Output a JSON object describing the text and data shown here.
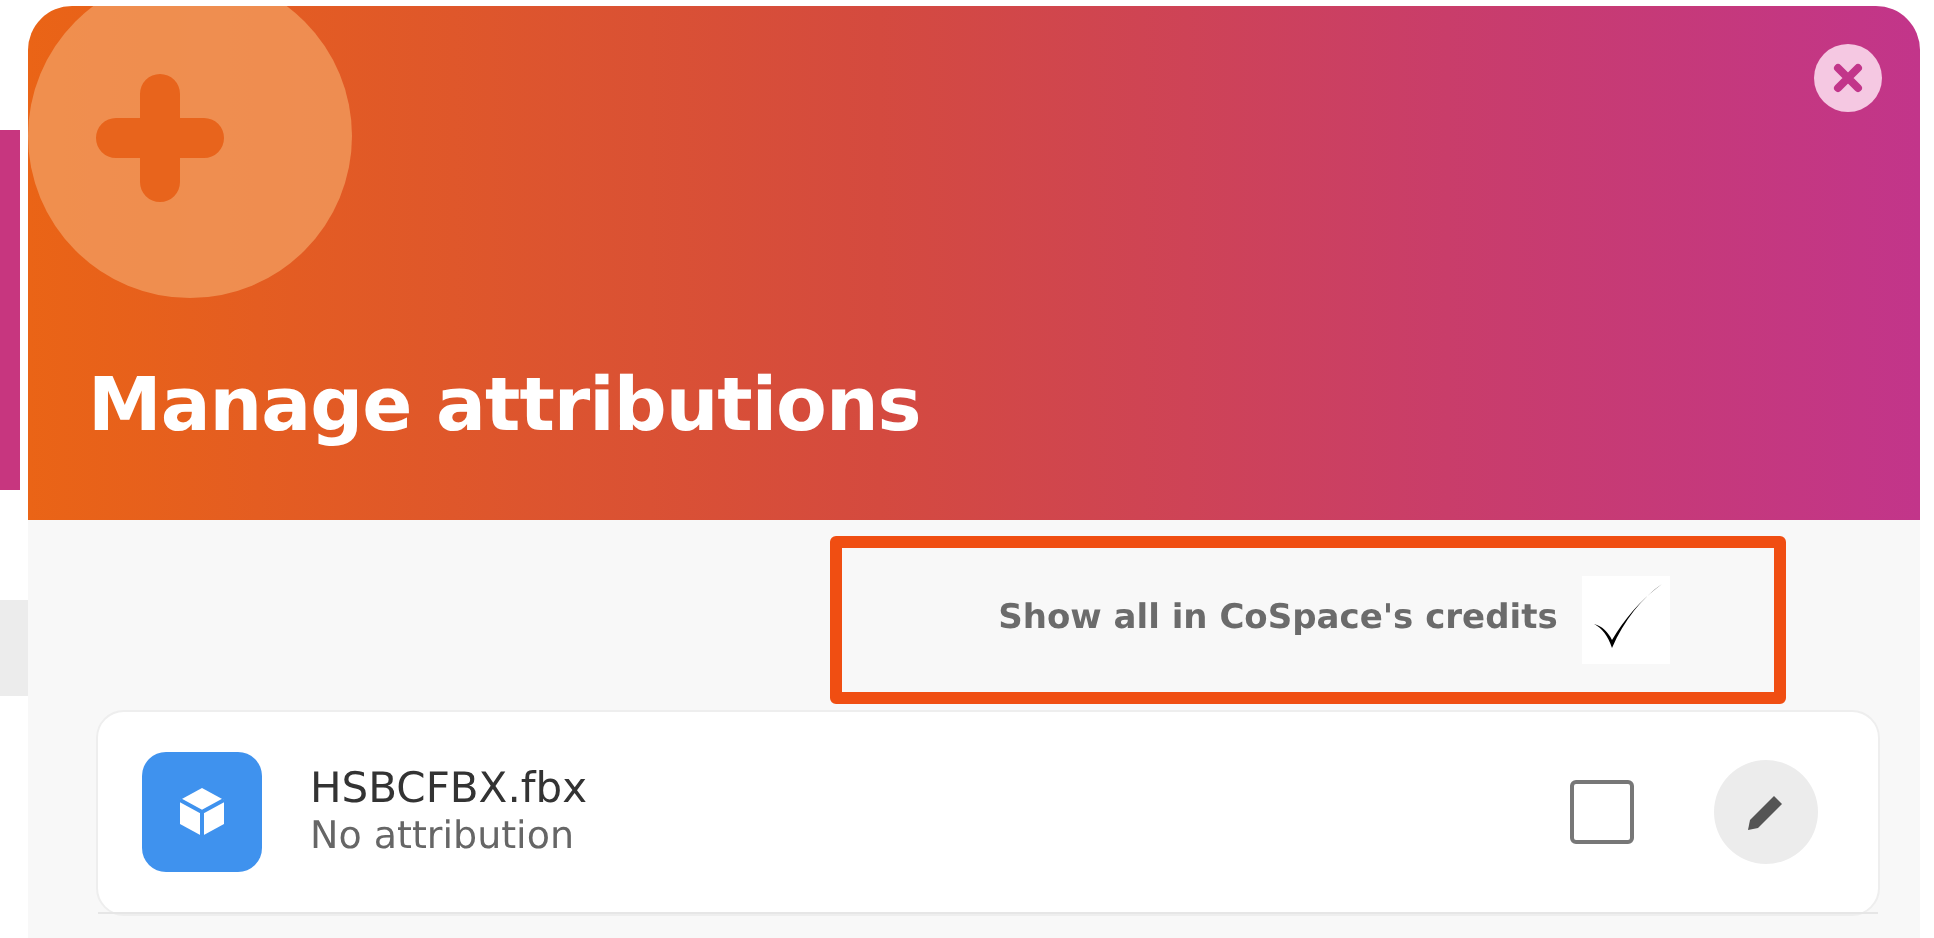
{
  "dialog": {
    "title": "Manage attributions"
  },
  "credits_toggle": {
    "label": "Show all in CoSpace's credits",
    "checked": true,
    "highlighted": true
  },
  "assets": [
    {
      "name": "HSBCFBX.fbx",
      "attribution": "No attribution",
      "checked": false
    }
  ]
}
